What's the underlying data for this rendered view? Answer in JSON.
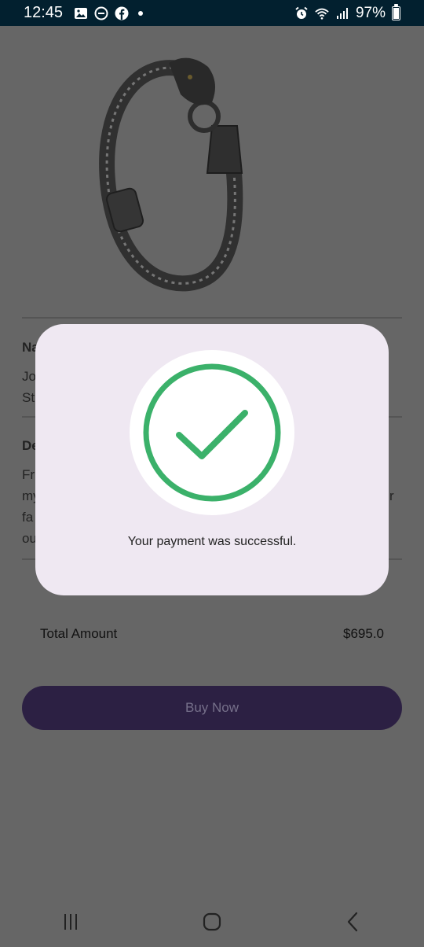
{
  "status_bar": {
    "time": "12:45",
    "battery": "97%",
    "left_icons": [
      "gallery-icon",
      "do-not-disturb-icon",
      "facebook-icon",
      "notification-dot-icon"
    ],
    "right_icons": [
      "alarm-icon",
      "wifi-icon",
      "signal-icon",
      "battery-icon"
    ]
  },
  "product": {
    "image": "bracelet-image",
    "sections": [
      {
        "title": "Na",
        "text_lines": [
          "Jo",
          "St"
        ]
      },
      {
        "title": "De",
        "text_lines": [
          "Fr",
          "my",
          "fa",
          "ou"
        ]
      }
    ],
    "description_tail": "r"
  },
  "total": {
    "label": "Total Amount",
    "value": "$695.0"
  },
  "buy_button": {
    "label": "Buy Now"
  },
  "dialog": {
    "message": "Your payment was successful.",
    "icon": "checkmark-circle-icon",
    "accent_color": "#3bb16a"
  },
  "nav": {
    "buttons": [
      "recent-apps-icon",
      "home-icon",
      "back-icon"
    ]
  }
}
